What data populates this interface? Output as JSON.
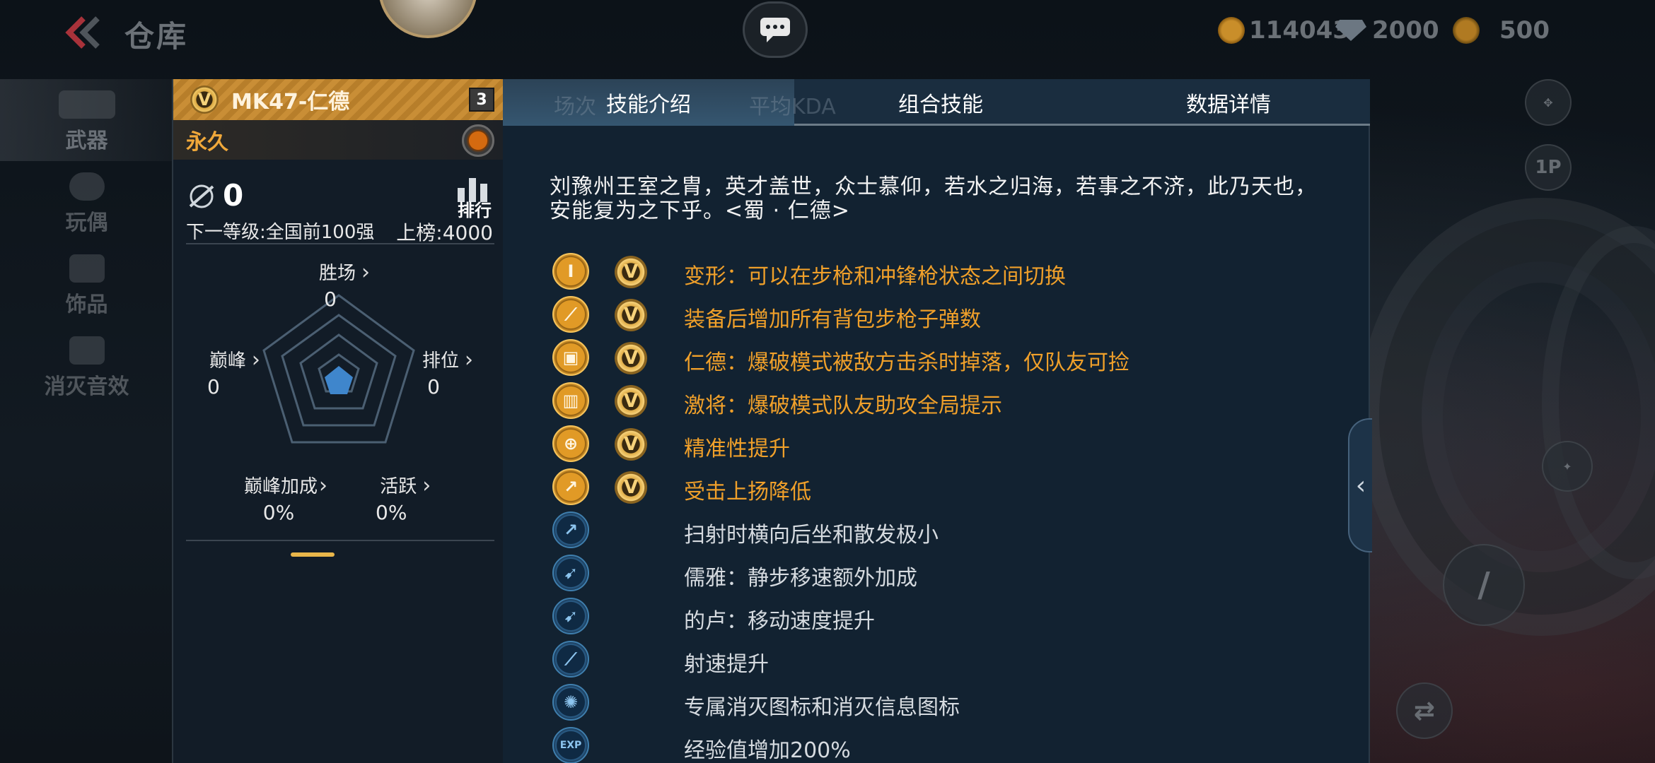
{
  "header": {
    "title": "仓库",
    "currencies": [
      {
        "icon": "gold-coin-icon",
        "value": "114043",
        "color": "#c98e2a"
      },
      {
        "icon": "diamond-icon",
        "value": "2000",
        "color": "#7b8894"
      },
      {
        "icon": "token-icon",
        "value": "500",
        "color": "#c98e2a"
      }
    ]
  },
  "nav": {
    "items": [
      {
        "label": "武器",
        "active": true
      },
      {
        "label": "玩偶"
      },
      {
        "label": "饰品"
      },
      {
        "label": "消灭音效"
      }
    ]
  },
  "weapon": {
    "badge": "V",
    "name": "MK47-仁德",
    "level": "3",
    "duration": "永久",
    "kills": "0",
    "rank_label": "排行",
    "next_level": "下一等级:全国前100强",
    "board": "上榜:4000",
    "stats": {
      "wins": {
        "label": "胜场",
        "value": "0"
      },
      "peak": {
        "label": "巅峰",
        "value": "0"
      },
      "rank": {
        "label": "排位",
        "value": "0"
      },
      "peak_bonus": {
        "label": "巅峰加成",
        "value": "0%"
      },
      "active": {
        "label": "活跃",
        "value": "0%"
      }
    }
  },
  "tabs": [
    {
      "label": "技能介绍",
      "active": true
    },
    {
      "label": "组合技能"
    },
    {
      "label": "数据详情"
    }
  ],
  "ghost_tabs": {
    "a": "场次",
    "b": "平均KDA"
  },
  "description": "刘豫州王室之胄，英才盖世，众士慕仰，若水之归海，若事之不济，此乃天也，安能复为之下乎。<蜀 · 仁德>",
  "skills": [
    {
      "icon": "transform-icon",
      "tier": "gold",
      "v": "V",
      "text": "变形：可以在步枪和冲锋枪状态之间切换"
    },
    {
      "icon": "rifle-icon",
      "tier": "gold",
      "v": "V",
      "text": "装备后增加所有背包步枪子弹数"
    },
    {
      "icon": "gift-icon",
      "tier": "gold",
      "v": "V",
      "text": "仁德：爆破模式被敌方击杀时掉落，仅队友可捡"
    },
    {
      "icon": "ammo-icon",
      "tier": "gold",
      "v": "V",
      "text": "激将：爆破模式队友助攻全局提示"
    },
    {
      "icon": "crosshair-icon",
      "tier": "gold",
      "v": "V",
      "text": "精准性提升"
    },
    {
      "icon": "recoil-icon",
      "tier": "gold",
      "v": "V",
      "text": "受击上扬降低"
    },
    {
      "icon": "spread-icon",
      "tier": "blue",
      "v": "",
      "text": "扫射时横向后坐和散发极小"
    },
    {
      "icon": "walk-icon",
      "tier": "blue",
      "v": "",
      "text": "儒雅：静步移速额外加成"
    },
    {
      "icon": "run-icon",
      "tier": "blue",
      "v": "",
      "text": "的卢：移动速度提升"
    },
    {
      "icon": "bullet-icon",
      "tier": "blue",
      "v": "",
      "text": "射速提升"
    },
    {
      "icon": "kill-mark-icon",
      "tier": "blue",
      "v": "",
      "text": "专属消灭图标和消灭信息图标"
    },
    {
      "icon": "exp-icon",
      "tier": "blue",
      "v": "",
      "text": "经验值增加200%"
    }
  ],
  "right_controls": {
    "view_label": "1P"
  }
}
